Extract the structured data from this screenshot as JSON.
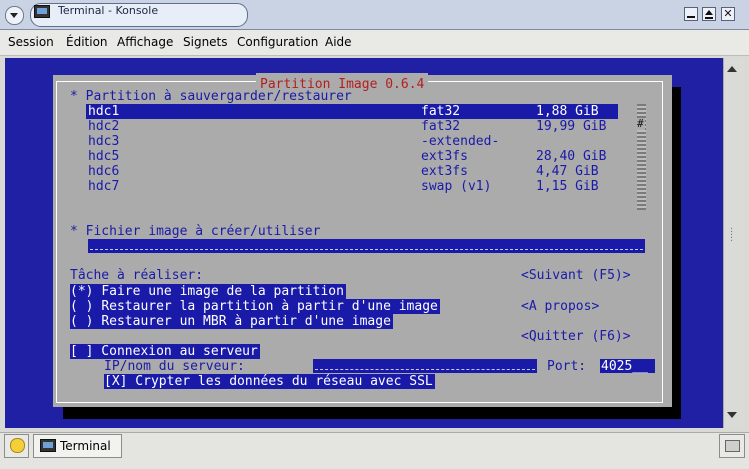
{
  "window": {
    "title": "Terminal - Konsole"
  },
  "menubar": [
    "Session",
    "Édition",
    "Affichage",
    "Signets",
    "Configuration",
    "Aide"
  ],
  "dialog": {
    "title": "Partition Image 0.6.4",
    "partition_header": "* Partition à sauvergarder/restaurer",
    "partitions": [
      {
        "name": "hdc1",
        "fs": "fat32",
        "size": "1,88 GiB",
        "selected": true
      },
      {
        "name": "hdc2",
        "fs": "fat32",
        "size": "19,99 GiB",
        "selected": false
      },
      {
        "name": "hdc3",
        "fs": "-extended-",
        "size": "",
        "selected": false
      },
      {
        "name": "hdc5",
        "fs": "ext3fs",
        "size": "28,40 GiB",
        "selected": false
      },
      {
        "name": "hdc6",
        "fs": "ext3fs",
        "size": "4,47 GiB",
        "selected": false
      },
      {
        "name": "hdc7",
        "fs": "swap (v1)",
        "size": "1,15 GiB",
        "selected": false
      }
    ],
    "scroll_marker": "#",
    "image_header": "* Fichier image à créer/utiliser",
    "image_value": "",
    "task_label": "Tâche à réaliser:",
    "tasks": [
      {
        "mark": "(*)",
        "label": "Faire une image de la partition",
        "selected": true
      },
      {
        "mark": "( )",
        "label": "Restaurer la partition à partir d'une image",
        "selected": false
      },
      {
        "mark": "( )",
        "label": "Restaurer un MBR à partir d'une image",
        "selected": false
      }
    ],
    "buttons": {
      "next": "<Suivant (F5)>",
      "about": "<A propos>",
      "quit": "<Quitter (F6)>"
    },
    "server": {
      "checkbox": "[ ] Connexion au serveur",
      "ip_label": "IP/nom du serveur:",
      "ip_value": "",
      "port_label": "Port:",
      "port_value": "4025__",
      "ssl": "[X] Crypter les données du réseau avec SSL"
    }
  },
  "taskbar": {
    "terminal_label": "Terminal"
  }
}
